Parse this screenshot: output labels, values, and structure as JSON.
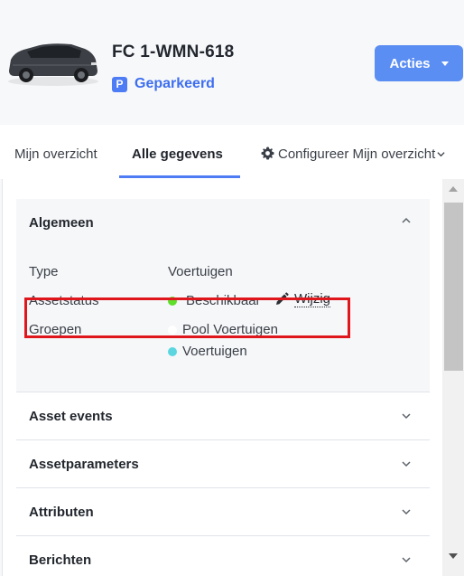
{
  "header": {
    "plate": "FC 1-WMN-618",
    "status_badge": "P",
    "status_text": "Geparkeerd",
    "actions_label": "Acties"
  },
  "tabs": [
    {
      "label": "Mijn overzicht",
      "active": false
    },
    {
      "label": "Alle gegevens",
      "active": true
    },
    {
      "label": "Configureer Mijn overzicht",
      "active": false
    }
  ],
  "general": {
    "title": "Algemeen",
    "rows": {
      "type_label": "Type",
      "type_value": "Voertuigen",
      "assetstatus_label": "Assetstatus",
      "assetstatus_value": "Beschikbaar",
      "assetstatus_color": "#5ee02b",
      "edit_label": "Wijzig",
      "groups_label": "Groepen",
      "groups": [
        {
          "name": "Pool Voertuigen",
          "color": "#ffffff"
        },
        {
          "name": "Voertuigen",
          "color": "#5bd6e0"
        }
      ]
    }
  },
  "sections": [
    {
      "title": "Asset events"
    },
    {
      "title": "Assetparameters"
    },
    {
      "title": "Attributen"
    },
    {
      "title": "Berichten"
    }
  ],
  "colors": {
    "accent": "#4d7cf5",
    "button": "#5b8ef2",
    "highlight": "#e0161d"
  }
}
